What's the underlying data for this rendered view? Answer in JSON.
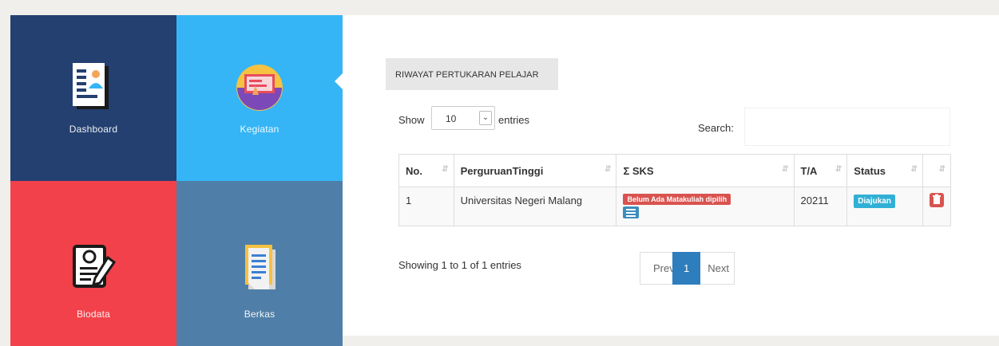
{
  "tiles": {
    "dashboard": {
      "label": "Dashboard",
      "icon": "dashboard-document-icon",
      "color": "#234070"
    },
    "kegiatan": {
      "label": "Kegiatan",
      "icon": "presentation-icon",
      "color": "#35b5f5"
    },
    "biodata": {
      "label": "Biodata",
      "icon": "profile-form-icon",
      "color": "#f2414a"
    },
    "berkas": {
      "label": "Berkas",
      "icon": "files-icon",
      "color": "#4f7fa8"
    }
  },
  "section": {
    "title": "RIWAYAT PERTUKARAN PELAJAR"
  },
  "controls": {
    "show_label": "Show",
    "entries_value": "10",
    "entries_label": "entries",
    "search_label": "Search:",
    "search_value": ""
  },
  "table": {
    "headers": {
      "no": "No.",
      "pt": "PerguruanTinggi",
      "sks": "Σ SKS",
      "ta": "T/A",
      "status": "Status",
      "action": ""
    },
    "rows": [
      {
        "no": "1",
        "pt": "Universitas Negeri Malang",
        "sks_badge": "Belum Ada Matakuliah dipilih",
        "ta": "20211",
        "status": "Diajukan"
      }
    ]
  },
  "footer": {
    "info": "Showing 1 to 1 of 1 entries",
    "prev": "Prev",
    "page": "1",
    "next": "Next"
  }
}
